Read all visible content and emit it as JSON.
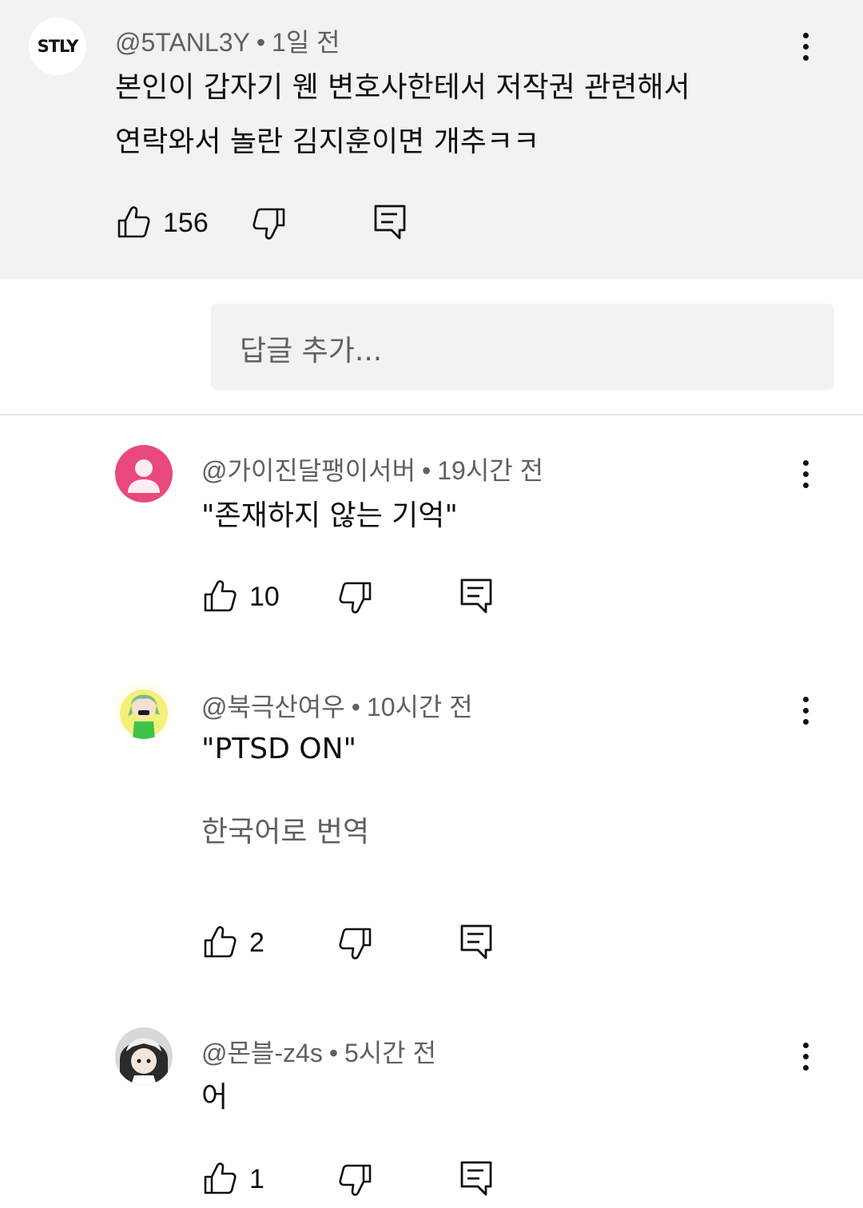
{
  "parent_comment": {
    "avatar_text": "STLY",
    "author": "@5TANL3Y",
    "separator": "•",
    "time": "1일 전",
    "lines": [
      "본인이 갑자기 웬 변호사한테서 저작권 관련해서",
      "연락와서 놀란 김지훈이면 개추ㅋㅋ"
    ],
    "likes": "156"
  },
  "reply_input": {
    "placeholder": "답글 추가..."
  },
  "replies": [
    {
      "author": "@가이진달팽이서버",
      "separator": "•",
      "time": "19시간 전",
      "text": "\"존재하지 않는 기억\"",
      "likes": "10",
      "avatar_color": "#e8497a"
    },
    {
      "author": "@북극산여우",
      "separator": "•",
      "time": "10시간 전",
      "text": "\"PTSD ON\"",
      "translate": "한국어로 번역",
      "likes": "2"
    },
    {
      "author": "@몬블-z4s",
      "separator": "•",
      "time": "5시간 전",
      "text": "어",
      "likes": "1"
    }
  ],
  "icons": [
    "thumb-up-icon",
    "thumb-down-icon",
    "reply-icon",
    "more-vert-icon"
  ]
}
